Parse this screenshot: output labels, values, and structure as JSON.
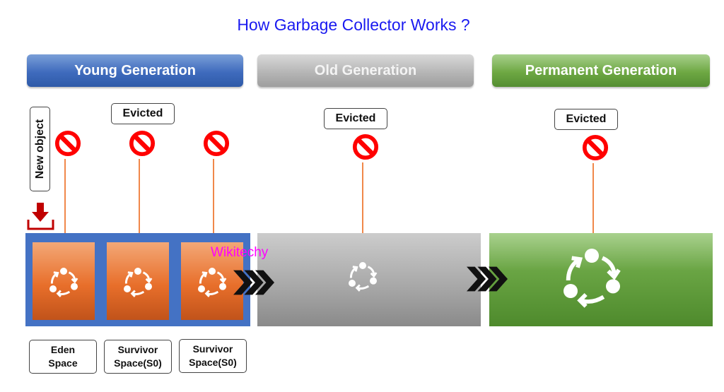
{
  "title": "How Garbage Collector Works ?",
  "generations": {
    "young": {
      "label": "Young Generation",
      "color": "#4472c4"
    },
    "old": {
      "label": "Old Generation",
      "color": "#a6a6a6"
    },
    "permanent": {
      "label": "Permanent  Generation",
      "color": "#70ad47"
    }
  },
  "new_object_label": "New object",
  "evicted_label": "Evicted",
  "young_spaces": [
    {
      "label_line1": "Eden",
      "label_line2": "Space"
    },
    {
      "label_line1": "Survivor",
      "label_line2": "Space(S0)"
    },
    {
      "label_line1": "Survivor",
      "label_line2": "Space(S0)"
    }
  ],
  "watermark": "Wikitechy",
  "colors": {
    "arrow_line": "#f0884a",
    "no_entry": "#ff0000",
    "download_arrow": "#c00000",
    "space_fill": "#e86f2b"
  },
  "icons": {
    "evict": "no-entry-icon",
    "cycle": "recycle-cycle-icon",
    "transfer": "chevron-triple-right-icon",
    "insert": "download-arrow-icon"
  }
}
